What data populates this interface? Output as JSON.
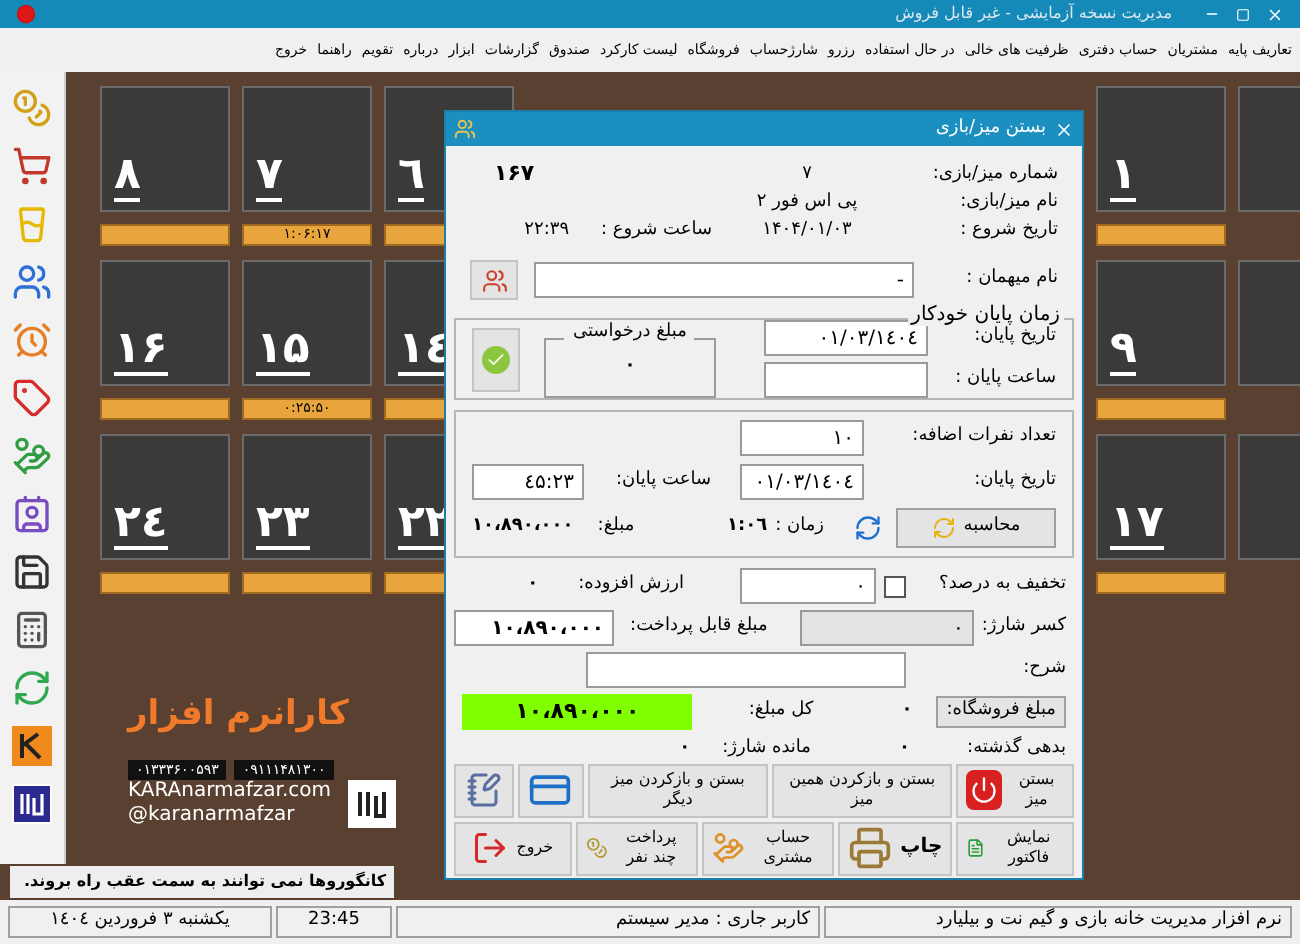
{
  "window": {
    "title": "مدیریت نسخه آزمایشی - غیر قابل فروش"
  },
  "menu": [
    "تعاریف پایه",
    "مشتریان",
    "حساب دفتری",
    "ظرفیت های خالی",
    "در حال استفاده",
    "رزرو",
    "شارژحساب",
    "فروشگاه",
    "لیست کارکرد",
    "صندوق",
    "گزارشات",
    "ابزار",
    "درباره",
    "تقویم",
    "راهنما",
    "خروج"
  ],
  "tiles_left": [
    {
      "number": "٦"
    },
    {
      "number": "۷",
      "timer": "۱:۰۶:۱۷"
    },
    {
      "number": "۸"
    },
    {
      "number": "۱٤"
    },
    {
      "number": "۱۵",
      "timer": "۰:۲۵:۵۰"
    },
    {
      "number": "۱۶"
    },
    {
      "number": "۲۲"
    },
    {
      "number": "۲۳"
    },
    {
      "number": "۲٤"
    }
  ],
  "tiles_right": [
    {
      "number": "۱"
    },
    {
      "number": "۹"
    },
    {
      "number": "۱۷"
    }
  ],
  "branding": {
    "name": "کارانرم افزار",
    "phones": [
      "۰۹۱۱۱۴۸۱۳۰۰",
      "۰۱۳۳۳۶۰۰۵۹۳"
    ],
    "website": "KARAnarmafzar.com",
    "handle": "@karanarmafzar"
  },
  "status_message": "کانگوروها نمی توانند به سمت عقب راه بروند.",
  "status_bar": {
    "app": "نرم افزار مدیریت خانه بازی و گیم نت و بیلیارد",
    "user": "کاربر جاری : مدیر سیستم",
    "time": "23:45",
    "date": "یکشنبه ۳ فروردین ۱٤۰٤"
  },
  "dialog": {
    "title": "بستن میز/بازی",
    "info": [
      {
        "label": "شماره میز/بازی:",
        "value": "۷"
      },
      {
        "label": "نام میز/بازی:",
        "value": "پی اس فور ۲"
      },
      {
        "label": "تاریخ شروع :",
        "value": "۱۴۰۴/۰۱/۰۳"
      }
    ],
    "count": "۱۶۷",
    "start_time": {
      "label": "ساعت شروع :",
      "value": "۲۲:۳۹"
    },
    "guest": {
      "label": "نام میهمان :",
      "value": "-"
    },
    "auto_end": {
      "title": "زمان پایان خودکار",
      "end_date": {
        "label": "تاریخ پایان:",
        "value": "۱٤۰٤/۰۱/۰۳"
      },
      "end_time": {
        "label": "ساعت پایان :"
      },
      "requested": {
        "title": "مبلغ درخواستی",
        "value": "۰"
      }
    },
    "extra_people": {
      "label": "تعداد نفرات اضافه:",
      "value": "۱۰"
    },
    "end_date": {
      "label": "تاریخ پایان:",
      "value": "۱٤۰٤/۰۱/۰۳"
    },
    "end_time": {
      "label": "ساعت پایان:",
      "value": "۲۳:٤۵"
    },
    "calculate": "محاسبه",
    "duration": {
      "label": "زمان :",
      "value": "۱:۰٦"
    },
    "amount": {
      "label": "مبلغ:",
      "value": "۱۰،۸۹۰،۰۰۰"
    },
    "discount": {
      "label": "تخفیف به درصد؟",
      "checked": false,
      "value": "۰"
    },
    "vat": {
      "label": "ارزش افزوده:",
      "value": "۰"
    },
    "charge": {
      "label": "کسر شارژ:",
      "value": "۰",
      "disabled": true
    },
    "payable": {
      "label": "مبلغ قابل پرداخت:",
      "value": "۱۰،۸۹۰،۰۰۰"
    },
    "description": {
      "label": "شرح:"
    },
    "shop": {
      "label": "مبلغ فروشگاه:",
      "value": "۰"
    },
    "total": {
      "label": "کل مبلغ:",
      "value": "۱۰،۸۹۰،۰۰۰"
    },
    "debt": {
      "label": "بدهی گذشته:",
      "value": "۰"
    },
    "charge_left": {
      "label": "مانده شارژ:",
      "value": "۰"
    },
    "buttons": [
      {
        "kind": "close",
        "label": "بستن میز"
      },
      {
        "kind": "reopen",
        "label": "بستن و بازکردن همین میز"
      },
      {
        "kind": "other",
        "label": "بستن و بازکردن میز دیگر"
      },
      {
        "kind": "pos"
      },
      {
        "kind": "notes"
      }
    ],
    "buttons2": [
      {
        "kind": "invoice",
        "label": "نمایش فاکتور"
      },
      {
        "kind": "print",
        "label": "چاپ"
      },
      {
        "kind": "account",
        "label": "حساب مشتری"
      },
      {
        "kind": "split",
        "label": "پرداخت چند نفر"
      },
      {
        "kind": "exit",
        "label": "خروج"
      }
    ]
  }
}
